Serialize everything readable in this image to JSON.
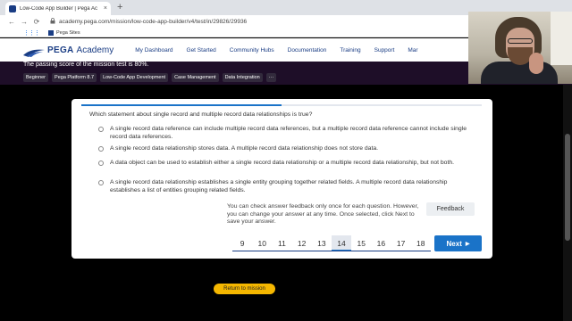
{
  "browser": {
    "tab_title": "Low-Code App Builder | Pega Ac",
    "tab_close": "×",
    "new_tab": "+",
    "url": "academy.pega.com/mission/low-code-app-builder/v4/test/in/29826/29936",
    "bookmark_apps_icon": "⋮⋮⋮",
    "bookmark_label": "Pega Sites"
  },
  "header": {
    "logo_pega": "PEGA",
    "logo_academy": "Academy",
    "nav": [
      "My Dashboard",
      "Get Started",
      "Community Hubs",
      "Documentation",
      "Training",
      "Support",
      "Mar"
    ]
  },
  "hero": {
    "text": "The passing score of the mission test is 80%.",
    "tags": [
      "Beginner",
      "Pega Platform 8.7",
      "Low-Code App Development",
      "Case Management",
      "Data Integration",
      "···"
    ]
  },
  "quiz": {
    "progress": 0.5,
    "question": "Which statement about single record and multiple record data relationships is true?",
    "options": [
      "A single record data reference can include multiple record data references, but a multiple record data reference cannot include single record data references.",
      "A single record data relationship stores data. A multiple record data relationship does not store data.",
      "A data object can be used to establish either a single record data relationship or a multiple record data relationship, but not both.",
      "A single record data relationship establishes a single entity grouping together related fields. A multiple record data relationship establishes a list of entities grouping related fields."
    ],
    "feedback_note": "You can check answer feedback only once for each question. However, you can change your answer at any time. Once selected, click Next to save your answer.",
    "feedback_label": "Feedback",
    "pages": [
      "9",
      "10",
      "11",
      "12",
      "13",
      "14",
      "15",
      "16",
      "17",
      "18"
    ],
    "current_page": "14",
    "next_label": "Next",
    "next_arrow": "▶",
    "return_label": "Return to mission"
  },
  "colors": {
    "brand_navy": "#1a3d84",
    "accent_blue": "#1a73c8",
    "hero_purple": "#1e0e28",
    "return_yellow": "#f5b700"
  },
  "icons": {
    "back": "←",
    "forward": "→",
    "reload": "⟳",
    "lock": "🔒"
  }
}
